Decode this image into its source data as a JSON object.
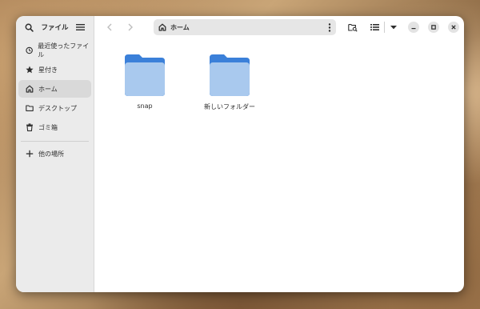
{
  "sidebar": {
    "title": "ファイル",
    "items": [
      {
        "label": "最近使ったファイル",
        "icon": "clock-icon"
      },
      {
        "label": "星付き",
        "icon": "star-icon"
      },
      {
        "label": "ホーム",
        "icon": "home-icon"
      },
      {
        "label": "デスクトップ",
        "icon": "folder-icon"
      },
      {
        "label": "ゴミ箱",
        "icon": "trash-icon"
      }
    ],
    "other": {
      "label": "他の場所",
      "icon": "plus-icon"
    }
  },
  "pathbar": {
    "label": "ホーム",
    "icon": "home-icon"
  },
  "files": [
    {
      "name": "snap",
      "icon": "folder-icon"
    },
    {
      "name": "新しいフォルダー",
      "icon": "folder-icon"
    }
  ],
  "colors": {
    "folder_back": "#3b80d9",
    "folder_front": "#a9c9ee",
    "sidebar_bg": "#ebebeb",
    "accent_text": "#2e2e2e"
  }
}
